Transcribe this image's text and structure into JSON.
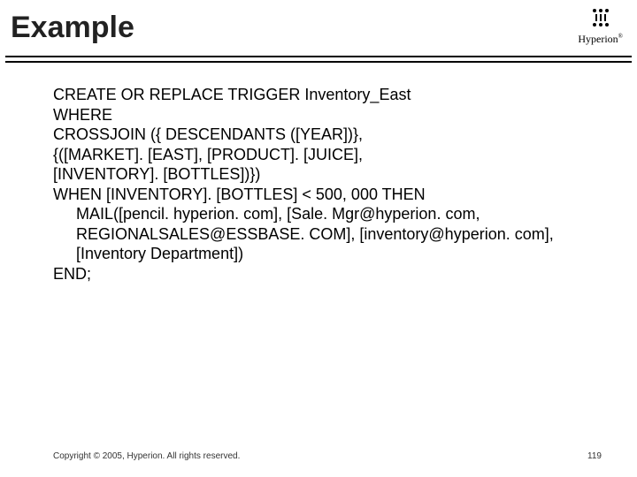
{
  "title": "Example",
  "logo": {
    "text": "Hyperion",
    "trademark": "®"
  },
  "code": {
    "l1": "CREATE OR REPLACE TRIGGER Inventory_East",
    "l2": "WHERE",
    "l3": "CROSSJOIN ({ DESCENDANTS ([YEAR])},",
    "l4": "{([MARKET]. [EAST], [PRODUCT]. [JUICE],",
    "l5": "[INVENTORY]. [BOTTLES])})",
    "l6": "WHEN [INVENTORY]. [BOTTLES] < 500, 000 THEN",
    "l7": "MAIL([pencil. hyperion. com], [Sale. Mgr@hyperion. com,",
    "l8": "REGIONALSALES@ESSBASE. COM], [inventory@hyperion. com],",
    "l9": "[Inventory Department])",
    "l10": "END;"
  },
  "footer": {
    "copyright": "Copyright © 2005, Hyperion. All rights reserved.",
    "page": "119"
  }
}
